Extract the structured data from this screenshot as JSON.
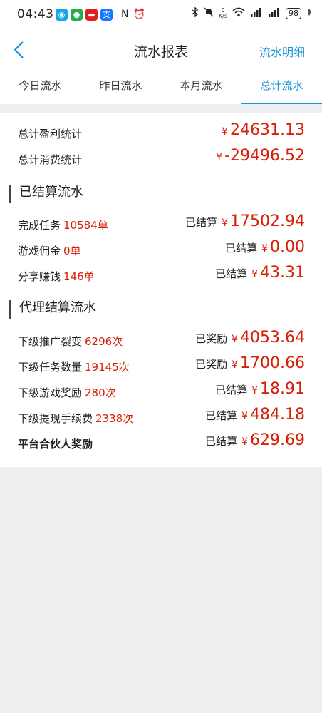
{
  "status_bar": {
    "time": "04:43",
    "apps": [
      {
        "icon": "chat-bubble-icon",
        "color": "#14a6e8",
        "glyph": "◉"
      },
      {
        "icon": "wechat-icon",
        "color": "#22b04b",
        "glyph": "●"
      },
      {
        "icon": "store-icon",
        "color": "#e02020",
        "glyph": "▬"
      },
      {
        "icon": "alipay-icon",
        "color": "#1677ff",
        "glyph": "支"
      }
    ],
    "left_icons": [
      "N",
      "⏰"
    ],
    "net_speed_top": "0",
    "net_speed_unit": "K/s",
    "battery": "98"
  },
  "header": {
    "title": "流水报表",
    "detail_link": "流水明细"
  },
  "tabs": [
    {
      "label": "今日流水",
      "active": false
    },
    {
      "label": "昨日流水",
      "active": false
    },
    {
      "label": "本月流水",
      "active": false
    },
    {
      "label": "总计流水",
      "active": true
    }
  ],
  "summary": {
    "profit_label": "总计盈利统计",
    "profit_yen": "¥",
    "profit_value": "24631.13",
    "cost_label": "总计消费统计",
    "cost_yen": "¥",
    "cost_value": "-29496.52"
  },
  "settled_section": {
    "title": "已结算流水",
    "rows": [
      {
        "label": "完成任务",
        "count": "10584单",
        "status": "已结算",
        "yen": "¥",
        "amount": "17502.94"
      },
      {
        "label": "游戏佣金",
        "count": "0单",
        "status": "已结算",
        "yen": "¥",
        "amount": "0.00"
      },
      {
        "label": "分享赚钱",
        "count": "146单",
        "status": "已结算",
        "yen": "¥",
        "amount": "43.31"
      }
    ]
  },
  "agent_section": {
    "title": "代理结算流水",
    "rows": [
      {
        "label": "下级推广裂变",
        "count": "6296次",
        "status": "已奖励",
        "yen": "¥",
        "amount": "4053.64"
      },
      {
        "label": "下级任务数量",
        "count": "19145次",
        "status": "已奖励",
        "yen": "¥",
        "amount": "1700.66"
      },
      {
        "label": "下级游戏奖励",
        "count": "280次",
        "status": "已结算",
        "yen": "¥",
        "amount": "18.91"
      },
      {
        "label": "下级提现手续费",
        "count": "2338次",
        "status": "已结算",
        "yen": "¥",
        "amount": "484.18"
      },
      {
        "label": "平台合伙人奖励",
        "count": "",
        "status": "已结算",
        "yen": "¥",
        "amount": "629.69"
      }
    ]
  },
  "colors": {
    "accent": "#1a91d8",
    "amount": "#d81e06",
    "background": "#eeeef0"
  }
}
